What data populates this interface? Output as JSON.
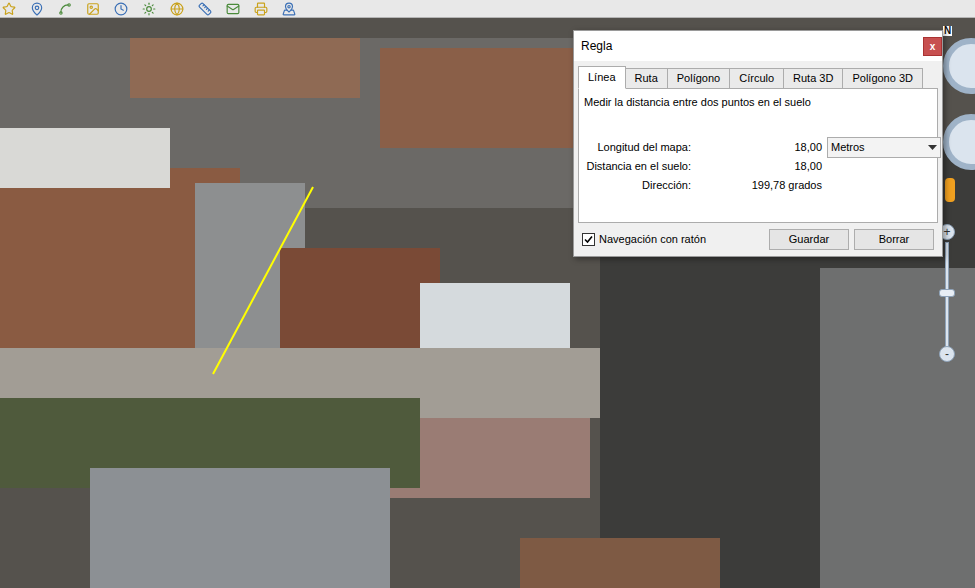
{
  "dialog": {
    "title": "Regla",
    "close": "x",
    "tabs": [
      {
        "label": "Línea",
        "selected": true
      },
      {
        "label": "Ruta",
        "selected": false
      },
      {
        "label": "Polígono",
        "selected": false
      },
      {
        "label": "Círculo",
        "selected": false
      },
      {
        "label": "Ruta 3D",
        "selected": false
      },
      {
        "label": "Polígono 3D",
        "selected": false
      }
    ],
    "description": "Medir la distancia entre dos puntos en el suelo",
    "rows": [
      {
        "label": "Longitud del mapa:",
        "value": "18,00",
        "unit": "Metros"
      },
      {
        "label": "Distancia en el suelo:",
        "value": "18,00"
      },
      {
        "label": "Dirección:",
        "value": "199,78 grados"
      }
    ],
    "mouse_navigation": {
      "label": "Navegación con ratón",
      "checked": true
    },
    "buttons": [
      "Guardar",
      "Borrar"
    ]
  },
  "navigation": {
    "north": "N",
    "zoom_in": "+",
    "zoom_out": "-",
    "zoom_level": 0.5
  }
}
